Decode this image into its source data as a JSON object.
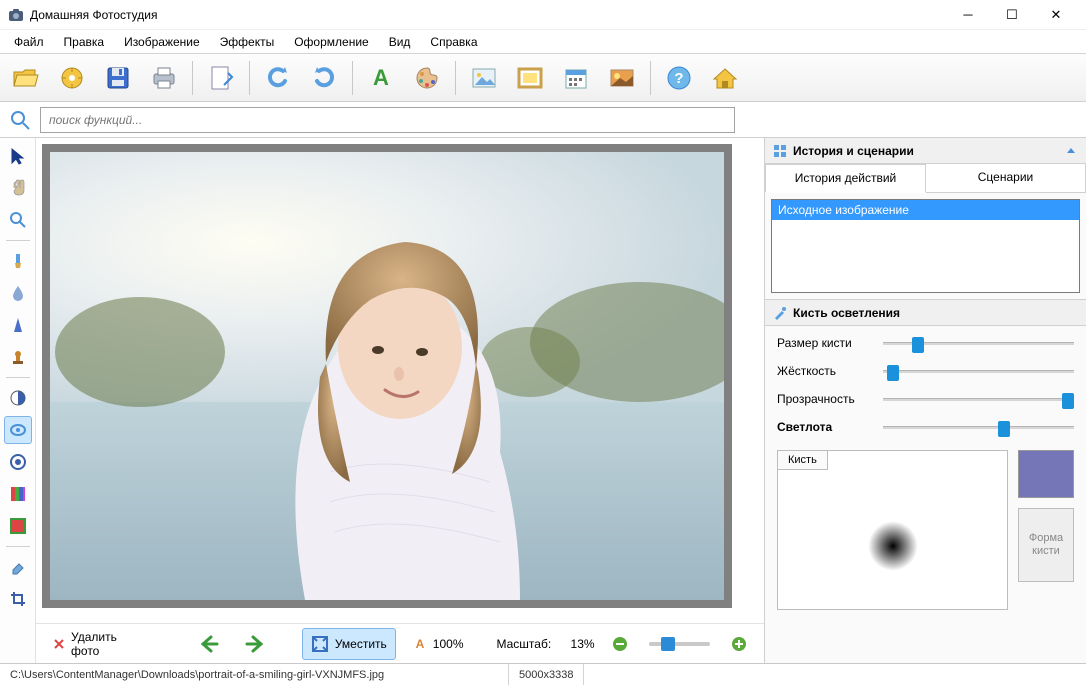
{
  "app": {
    "title": "Домашняя Фотостудия"
  },
  "menu": [
    "Файл",
    "Правка",
    "Изображение",
    "Эффекты",
    "Оформление",
    "Вид",
    "Справка"
  ],
  "search": {
    "placeholder": "поиск функций..."
  },
  "history_panel": {
    "title": "История и сценарии",
    "tabs": [
      "История действий",
      "Сценарии"
    ],
    "items": [
      "Исходное изображение"
    ]
  },
  "brush_panel": {
    "title": "Кисть осветления",
    "params": {
      "size": {
        "label": "Размер кисти",
        "value": 15
      },
      "hardness": {
        "label": "Жёсткость",
        "value": 2
      },
      "opacity": {
        "label": "Прозрачность",
        "value": 100
      },
      "lightness": {
        "label": "Светлота",
        "value": 60
      }
    },
    "preview_tab": "Кисть",
    "shape_button": "Форма кисти",
    "color": "#7476b8"
  },
  "bottombar": {
    "delete": "Удалить фото",
    "fit": "Уместить",
    "hundred": "100%",
    "scale_label": "Масштаб:",
    "scale_value": "13%"
  },
  "status": {
    "path": "C:\\Users\\ContentManager\\Downloads\\portrait-of-a-smiling-girl-VXNJMFS.jpg",
    "dims": "5000x3338"
  }
}
